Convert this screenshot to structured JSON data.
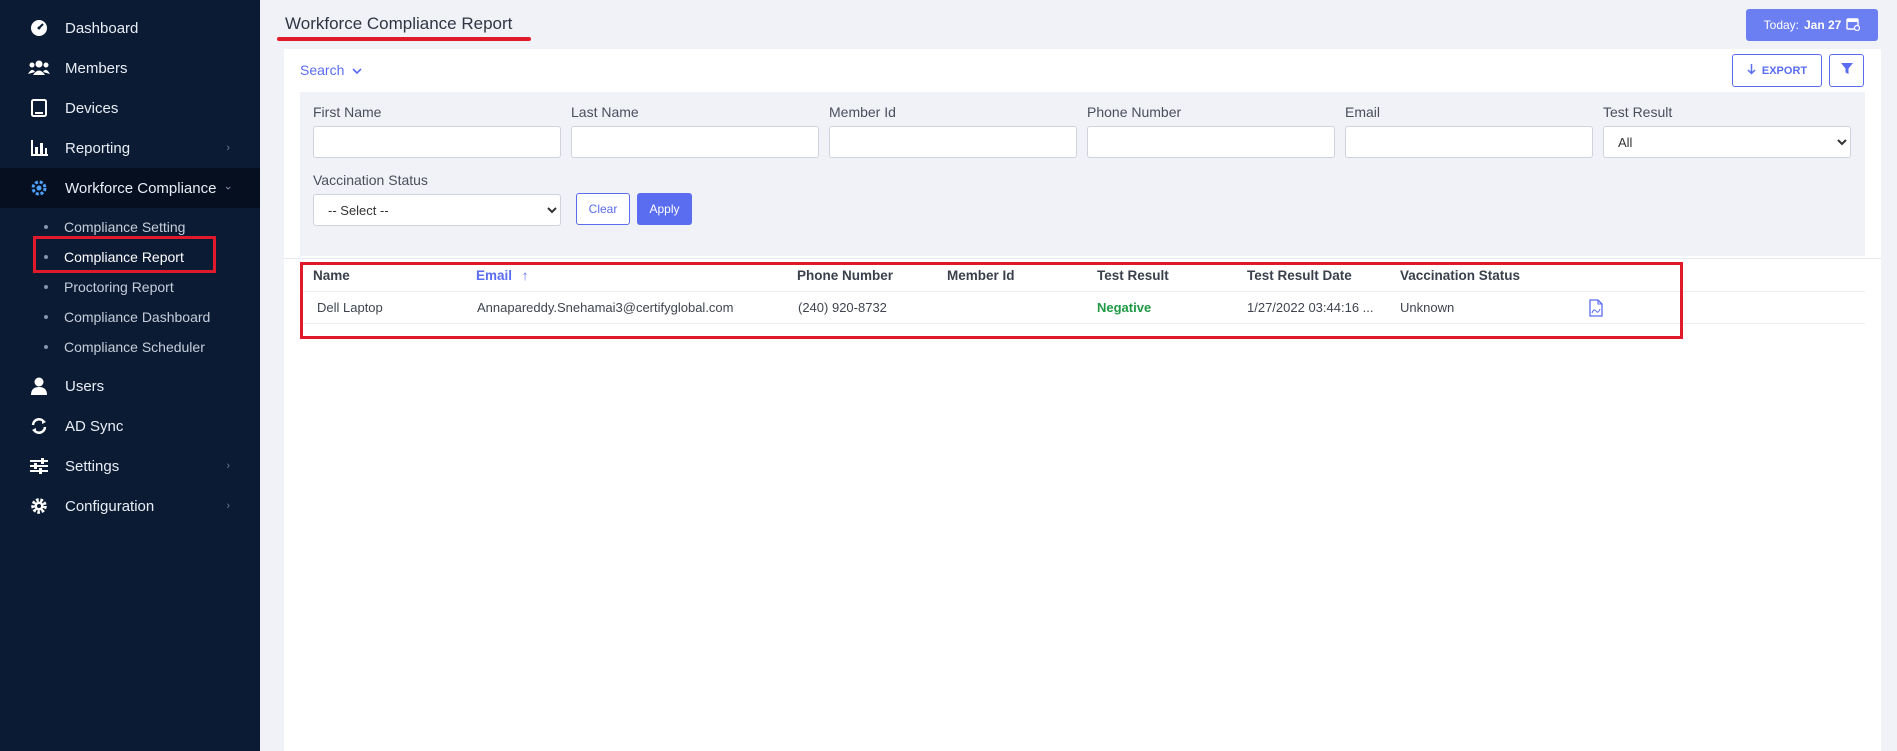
{
  "sidebar": {
    "items": [
      {
        "label": "Dashboard",
        "icon": "speedometer-icon"
      },
      {
        "label": "Members",
        "icon": "users-icon"
      },
      {
        "label": "Devices",
        "icon": "tablet-icon"
      },
      {
        "label": "Reporting",
        "icon": "bar-chart-icon",
        "has_chevron": true
      },
      {
        "label": "Workforce Compliance",
        "icon": "gear-icon",
        "active": true
      }
    ],
    "submenu": [
      {
        "label": "Compliance Setting"
      },
      {
        "label": "Compliance Report",
        "current": true
      },
      {
        "label": "Proctoring Report"
      },
      {
        "label": "Compliance Dashboard"
      },
      {
        "label": "Compliance Scheduler"
      }
    ],
    "bottom_items": [
      {
        "label": "Users",
        "icon": "user-icon"
      },
      {
        "label": "AD Sync",
        "icon": "sync-icon"
      },
      {
        "label": "Settings",
        "icon": "sliders-icon",
        "has_chevron": true
      },
      {
        "label": "Configuration",
        "icon": "cog-icon",
        "has_chevron": true
      }
    ]
  },
  "header": {
    "title": "Workforce Compliance Report",
    "today_label": "Today:",
    "today_date": "Jan 27"
  },
  "toolbar": {
    "search_label": "Search",
    "export_label": "EXPORT"
  },
  "filters": {
    "first_name": {
      "label": "First Name",
      "value": ""
    },
    "last_name": {
      "label": "Last Name",
      "value": ""
    },
    "member_id": {
      "label": "Member Id",
      "value": ""
    },
    "phone_number": {
      "label": "Phone Number",
      "value": ""
    },
    "email": {
      "label": "Email",
      "value": ""
    },
    "test_result": {
      "label": "Test Result",
      "selected": "All"
    },
    "vaccination_status": {
      "label": "Vaccination Status",
      "selected": "-- Select --"
    },
    "clear_label": "Clear",
    "apply_label": "Apply"
  },
  "table": {
    "columns": [
      "Name",
      "Email",
      "Phone Number",
      "Member Id",
      "Test Result",
      "Test Result Date",
      "Vaccination Status",
      ""
    ],
    "sort_column": "Email",
    "rows": [
      {
        "name": "Dell Laptop",
        "email": "Annapareddy.Snehamai3@certifyglobal.com",
        "phone": "(240) 920-8732",
        "member_id": "",
        "test_result": "Negative",
        "test_result_date": "1/27/2022 03:44:16 ...",
        "vaccination_status": "Unknown"
      }
    ]
  },
  "colors": {
    "accent": "#5a6cf0",
    "sidebar_bg": "#0b1b33",
    "highlight": "#e11a2b",
    "negative": "#1f9a45"
  }
}
